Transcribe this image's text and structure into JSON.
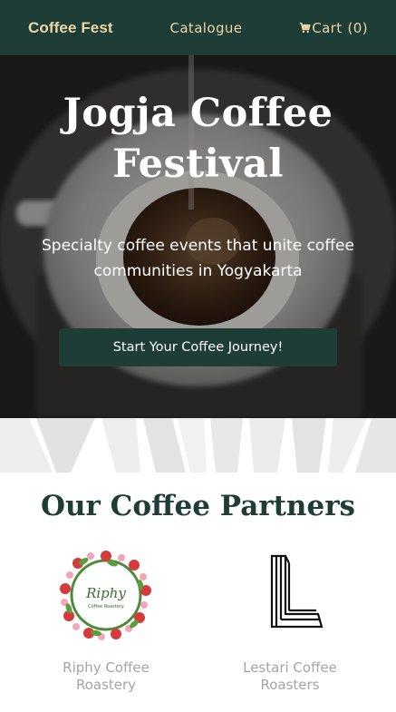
{
  "nav": {
    "brand": "Coffee Fest",
    "catalogue": "Catalogue",
    "cart_label": "Cart",
    "cart_count": "(0)",
    "cart_icon": "cart-icon"
  },
  "hero": {
    "title": "Jogja Coffee Festival",
    "subtitle": "Specialty coffee events that unite coffee communities in Yogyakarta",
    "button": "Start Your Coffee Journey!"
  },
  "partners": {
    "heading": "Our Coffee Partners",
    "items": [
      {
        "name": "Riphy Coffee Roastery",
        "logo_text": "Riphy",
        "logo_subtext": "Coffee Roastery"
      },
      {
        "name": "Lestari Coffee Roasters",
        "logo_icon": "lestari-l-logo"
      }
    ]
  },
  "colors": {
    "primary": "#1d3d36",
    "accent": "#ecd6a4",
    "muted_text": "#a5a5a5"
  }
}
